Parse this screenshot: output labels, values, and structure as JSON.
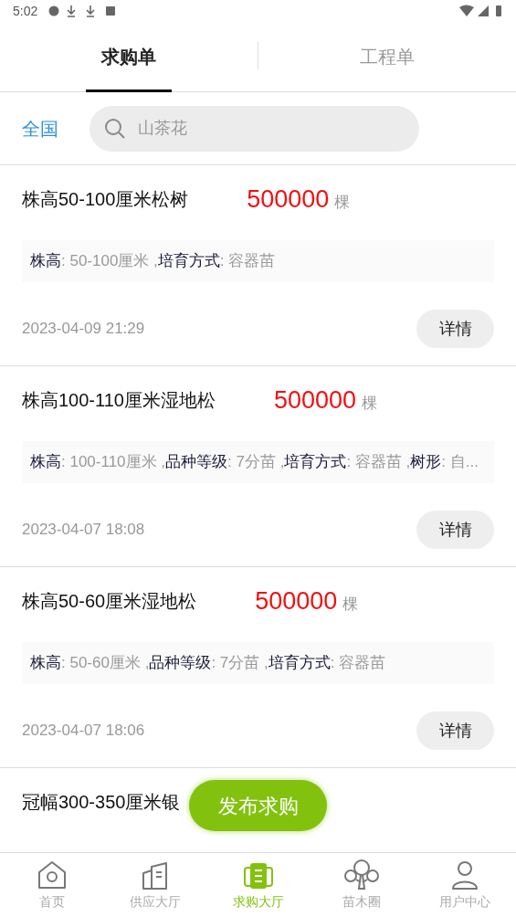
{
  "status_bar": {
    "time": "5:02"
  },
  "tabs": [
    {
      "label": "求购单",
      "selected": true
    },
    {
      "label": "工程单",
      "selected": false
    }
  ],
  "region": "全国",
  "search": {
    "placeholder": "山茶花"
  },
  "listings": [
    {
      "title": "株高50-100厘米松树",
      "quantity": "500000",
      "unit": "棵",
      "attributes": [
        {
          "name": "株高",
          "value": ": 50-100厘米 ,"
        },
        {
          "name": "培育方式",
          "value": ": 容器苗"
        }
      ],
      "date": "2023-04-09 21:29",
      "action": "详情"
    },
    {
      "title": "株高100-110厘米湿地松",
      "quantity": "500000",
      "unit": "棵",
      "attributes": [
        {
          "name": "株高",
          "value": ": 100-110厘米 ,"
        },
        {
          "name": "品种等级",
          "value": ": 7分苗 ,"
        },
        {
          "name": "培育方式",
          "value": ": 容器苗 ,"
        },
        {
          "name": "树形",
          "value": ": 自..."
        }
      ],
      "date": "2023-04-07 18:08",
      "action": "详情"
    },
    {
      "title": "株高50-60厘米湿地松",
      "quantity": "500000",
      "unit": "棵",
      "attributes": [
        {
          "name": "株高",
          "value": ": 50-60厘米 ,"
        },
        {
          "name": "品种等级",
          "value": ": 7分苗 ,"
        },
        {
          "name": "培育方式",
          "value": ": 容器苗"
        }
      ],
      "date": "2023-04-07 18:06",
      "action": "详情"
    },
    {
      "title": "冠幅300-350厘米银"
    }
  ],
  "publish_button": "发布求购",
  "bottom_nav": [
    {
      "kind": "home",
      "label": "首页",
      "selected": false
    },
    {
      "kind": "supply",
      "label": "供应大厅",
      "selected": false
    },
    {
      "kind": "purchase",
      "label": "求购大厅",
      "selected": true
    },
    {
      "kind": "circle",
      "label": "苗木圈",
      "selected": false
    },
    {
      "kind": "user",
      "label": "用户中心",
      "selected": false
    }
  ]
}
